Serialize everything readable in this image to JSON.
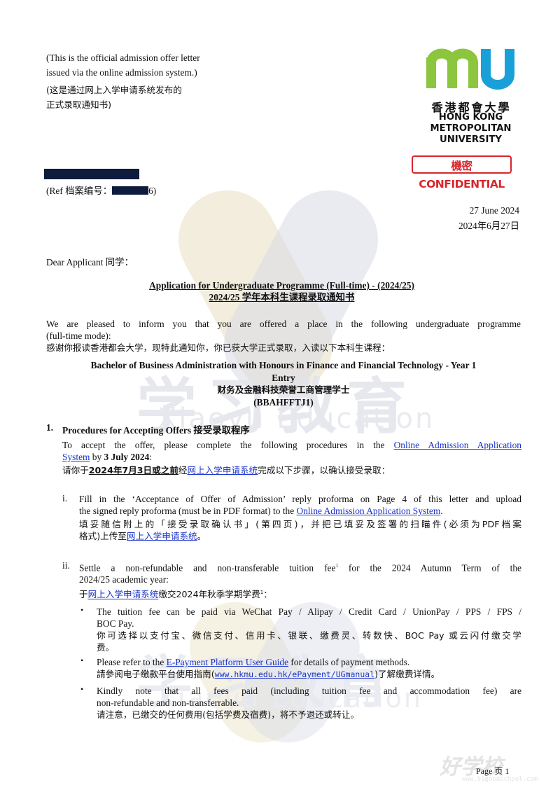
{
  "intro": {
    "note_en_line1": "(This is the official admission offer letter",
    "note_en_line2": "issued via the online admission system.)",
    "note_cn_line1": "(这是通过网上入学申请系统发布的",
    "note_cn_line2": "正式录取通知书)"
  },
  "logo": {
    "cn": "香港都會大學",
    "en_line1": "HONG KONG",
    "en_line2": "METROPOLITAN",
    "en_line3": "UNIVERSITY",
    "confidential": "機密CONFIDENTIAL",
    "mark": "mu",
    "mark_color_m": "#8cc63f",
    "mark_color_u": "#1aa0d8"
  },
  "ref": {
    "prefix": "(Ref 档案编号：",
    "suffix": "6)"
  },
  "date": {
    "en": "27 June 2024",
    "cn": "2024年6月27日"
  },
  "greeting": "Dear Applicant 同学：",
  "heading": {
    "en": "Application for Undergraduate Programme (Full-time) - (2024/25)",
    "cn": "2024/25 学年本科生课程录取通知书"
  },
  "intro_para": {
    "en_line1": "We are pleased to inform you that you are offered a place in the following undergraduate programme",
    "en_line2": "(full-time mode):",
    "cn": "感谢你报读香港都会大学，现特此通知你，你已获大学正式录取，入读以下本科生课程："
  },
  "programme": {
    "en_line1": "Bachelor of Business Administration with Honours in Finance and Financial Technology - Year 1",
    "en_line2": "Entry",
    "cn": "财务及金融科技荣誉工商管理学士",
    "code": "(BBAHFFTJ1)"
  },
  "section1": {
    "number": "1.",
    "title": "Procedures for Accepting Offers 接受录取程序",
    "p_en_line1_a": "To accept the offer, please complete the following procedures in the",
    "link_system_a": "Online Admission Application",
    "link_system_b": "System",
    "p_en_line2_b": " by ",
    "deadline_en": "3 July 2024",
    "p_en_line2_c": ":",
    "p_cn_a": "请你于",
    "deadline_cn": "2024年7月3日或之前",
    "p_cn_b": "经",
    "link_system_cn": "网上入学申请系统",
    "p_cn_c": "完成以下步骤，以确认接受录取："
  },
  "step_i": {
    "num": "i.",
    "en_line1": "Fill in the ‘Acceptance of Offer of Admission’ reply proforma on Page 4 of this letter and upload",
    "en_line2_a": "the signed reply proforma (must be in PDF format) to the ",
    "en_link": "Online Admission Application System",
    "en_line2_b": ".",
    "cn_line1": "填妥随信附上的「接受录取确认书」(第四页)，并把已填妥及签署的扫瞄件(必须为PDF档案",
    "cn_line2_a": "格式)上传至",
    "cn_link": "网上入学申请系统",
    "cn_line2_b": "。"
  },
  "step_ii": {
    "num": "ii.",
    "en_line1_a": "Settle a non-refundable and non-transferable tuition fee",
    "sup": "1",
    "en_line1_b": " for the 2024 Autumn Term of the",
    "en_line2": "2024/25 academic year:",
    "cn_a": "于",
    "cn_link": "网上入学申请系统",
    "cn_b": "缴交2024年秋季学期学费",
    "cn_sup": "1",
    "cn_c": "："
  },
  "bullets": [
    {
      "en_line1": "The tuition fee can be paid via WeChat Pay / Alipay / Credit Card / UnionPay / PPS / FPS /",
      "en_line2": "BOC Pay.",
      "cn_line1": "你可选择以支付宝、微信支付、信用卡、银联、缴费灵、转数快、BOC Pay 或云闪付缴交学",
      "cn_line2": "费。"
    },
    {
      "en_a": "Please refer to the ",
      "en_link": "E-Payment Platform User Guide",
      "en_b": " for details of payment methods.",
      "cn_a": "請參阅电子缴款平台使用指南(",
      "cn_link": "www.hkmu.edu.hk/ePayment/UGmanual",
      "cn_b": ")了解缴费详情。"
    },
    {
      "en_line1": "Kindly note that all fees paid (including tuition fee and accommodation fee) are",
      "en_line2": "non-refundable and non-transferrable.",
      "cn": "请注意，已缴交的任何费用(包括学费及宿费)，将不予退还或转让。"
    }
  ],
  "footer": {
    "page": "Page 页 1"
  },
  "watermark": {
    "cn": "学习教育",
    "en": "Xiaoyu Education",
    "corner": "好学校",
    "corner_sub": "www.91goodschool.com"
  }
}
